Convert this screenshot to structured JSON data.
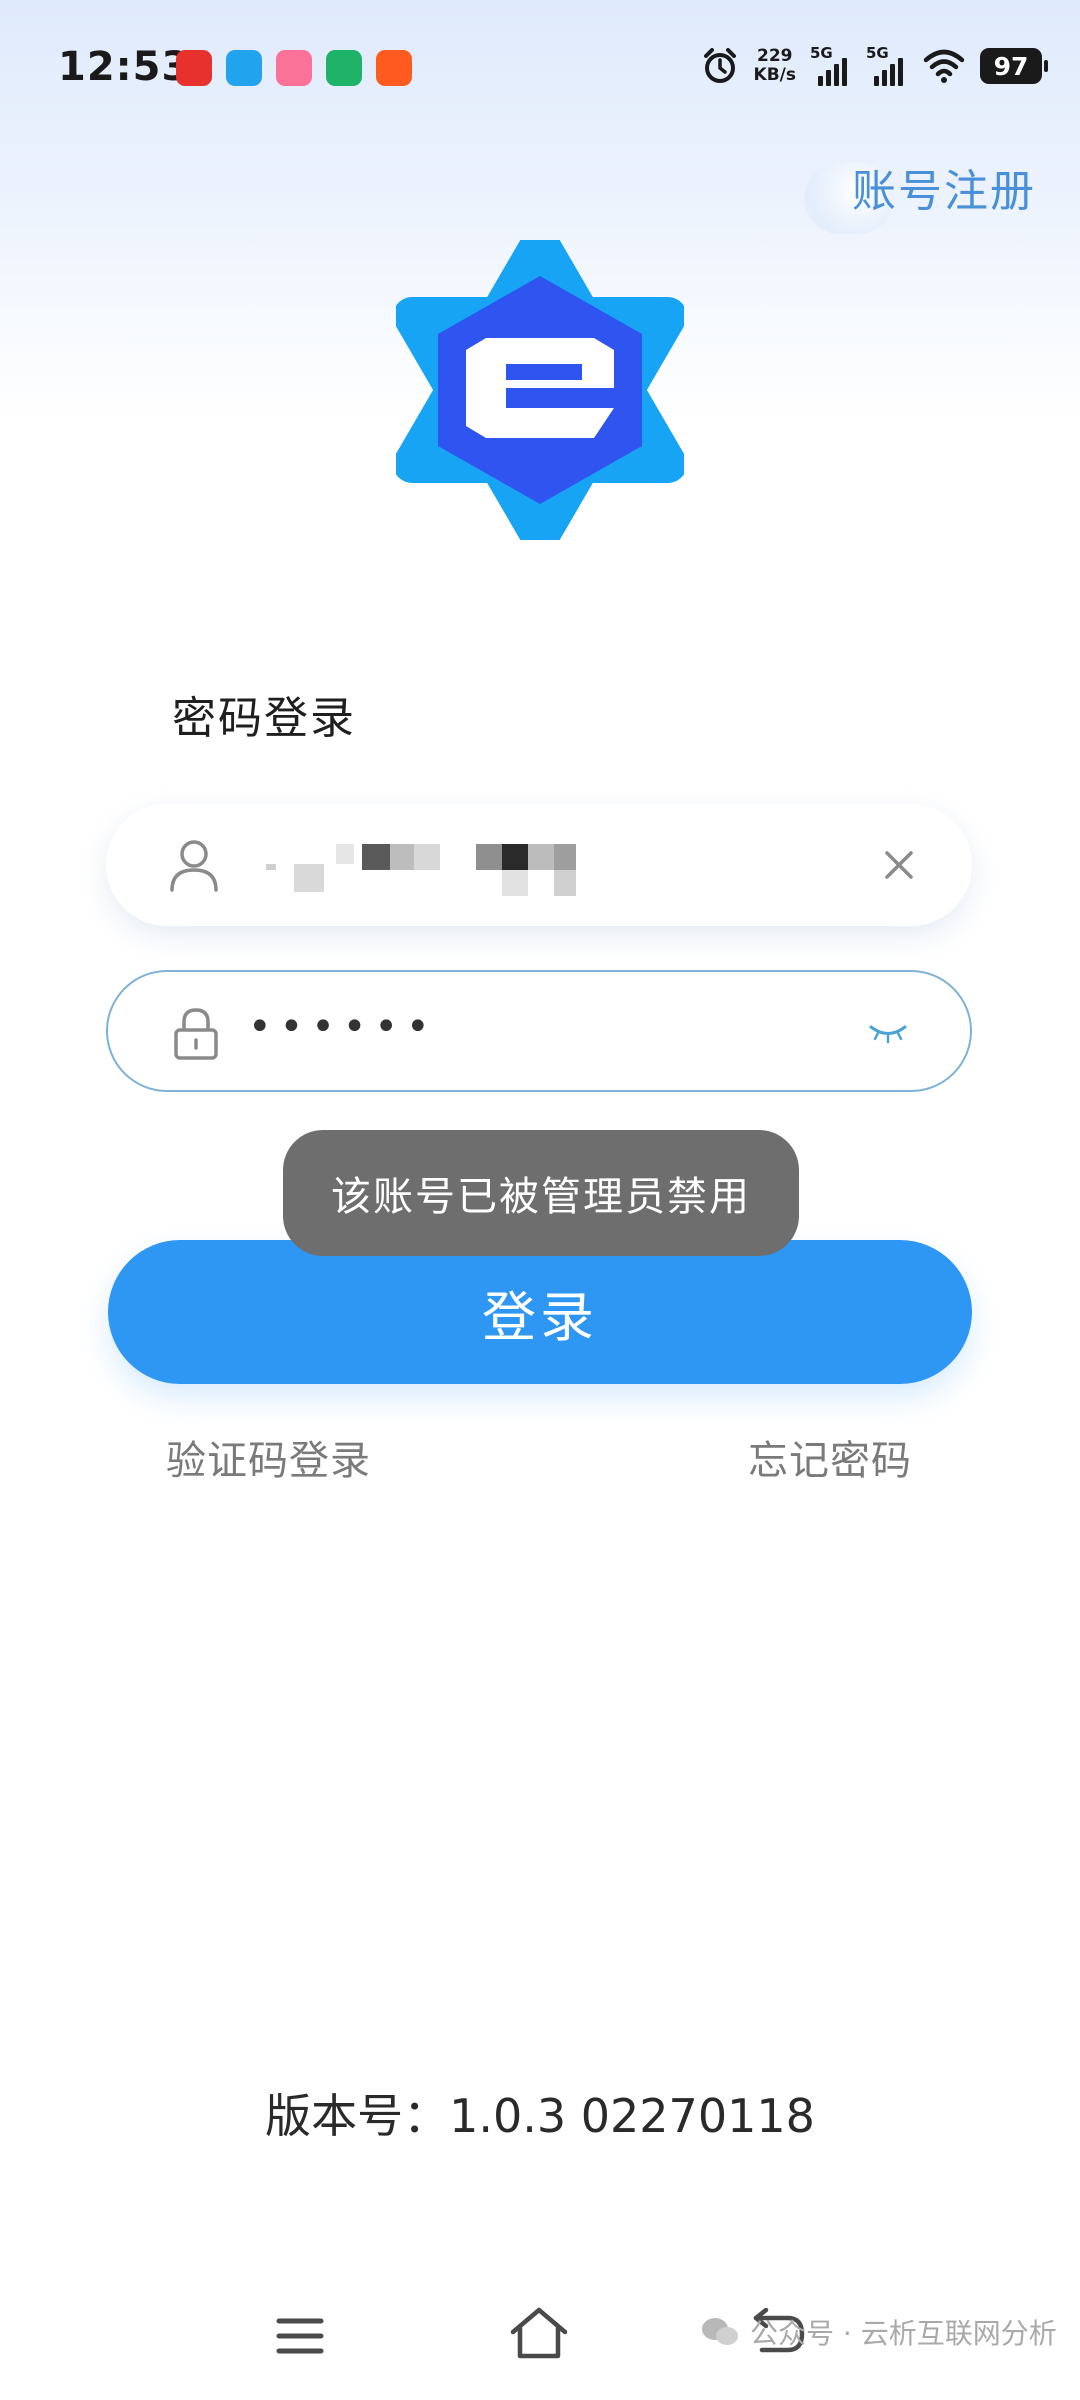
{
  "status_bar": {
    "time": "12:53",
    "net_speed_value": "229",
    "net_speed_unit": "KB/s",
    "signal1_label": "5G",
    "signal2_label": "5G",
    "battery": "97",
    "notification_icons": [
      "weibo-icon",
      "gallery-icon",
      "bilibili-icon",
      "wifi-app-icon",
      "kuaishou-icon"
    ],
    "colors": {
      "weibo": "#e6312d",
      "gallery": "#21a3ee",
      "bilibili": "#fb7299",
      "wifi_app": "#1fb36a",
      "kuaishou": "#ff5a1f"
    }
  },
  "header": {
    "register_label": "账号注册"
  },
  "logo": {
    "icon": "e-logo-icon",
    "colors": {
      "outer": "#17a4f5",
      "inner": "#2f54f0",
      "letter": "#ffffff"
    }
  },
  "form": {
    "title": "密码登录",
    "username": {
      "value": "",
      "icon": "user-icon",
      "clear_icon": "close-icon"
    },
    "password": {
      "masked": "••••••",
      "icon": "lock-icon",
      "toggle_icon": "eye-closed-icon"
    },
    "login_button": "登录",
    "sms_login_link": "验证码登录",
    "forgot_password_link": "忘记密码"
  },
  "toast": {
    "message": "该账号已被管理员禁用"
  },
  "footer": {
    "version": "版本号：1.0.3 02270118"
  },
  "watermark": {
    "text": "公众号 · 云析互联网分析"
  },
  "colors": {
    "primary": "#2e96f3",
    "link": "#4a90d9",
    "toast_bg": "#6e6e6e"
  }
}
